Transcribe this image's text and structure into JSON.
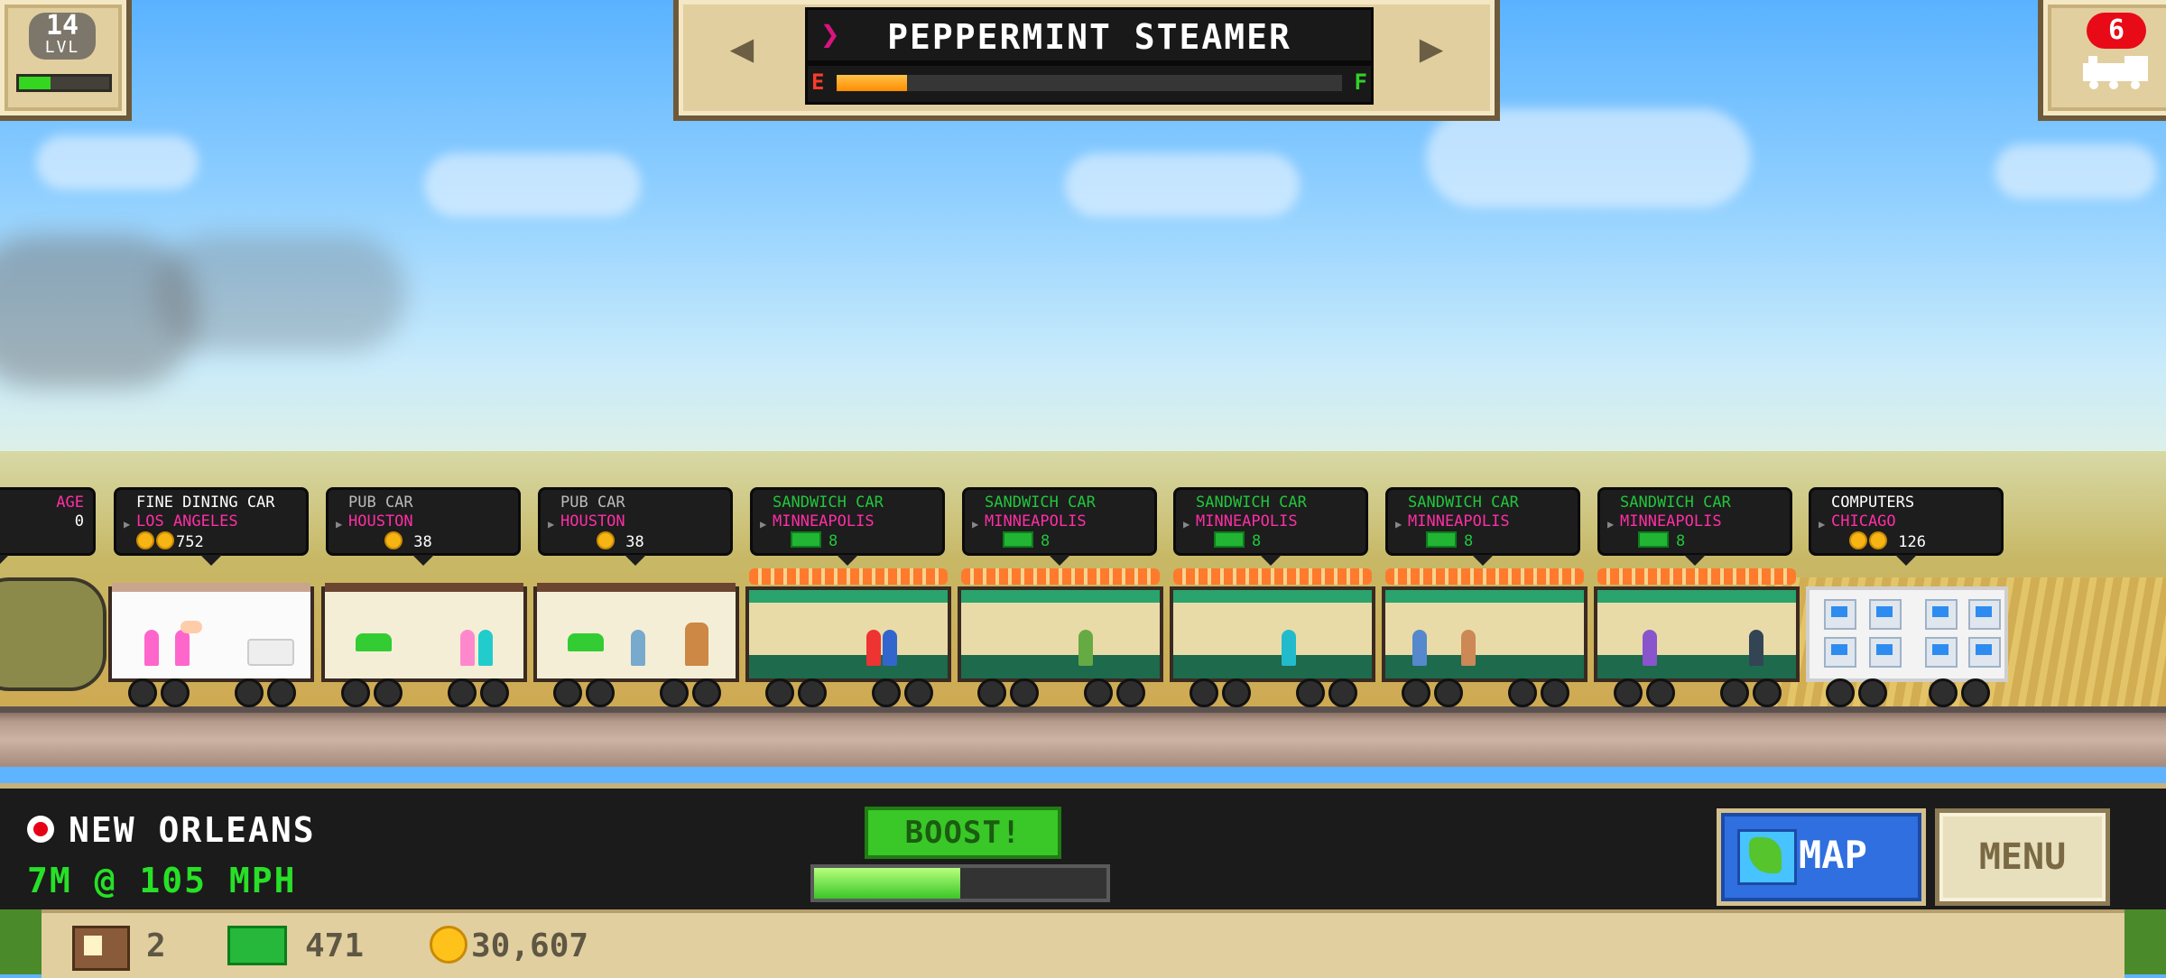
{
  "level": {
    "number": "14",
    "label": "LVL",
    "progress": 0.35
  },
  "train": {
    "name": "PEPPERMINT STEAMER",
    "fuel_empty_label": "E",
    "fuel_full_label": "F",
    "fuel_level": 0.14
  },
  "owned_trains": {
    "count": "6"
  },
  "cars": [
    {
      "title": "",
      "destination": "AGE",
      "amount": "0"
    },
    {
      "title": "FINE DINING CAR",
      "destination": "LOS ANGELES",
      "amount": "752"
    },
    {
      "title": "PUB CAR",
      "destination": "HOUSTON",
      "amount": "38"
    },
    {
      "title": "PUB CAR",
      "destination": "HOUSTON",
      "amount": "38"
    },
    {
      "title": "SANDWICH CAR",
      "destination": "MINNEAPOLIS",
      "amount": "8"
    },
    {
      "title": "SANDWICH CAR",
      "destination": "MINNEAPOLIS",
      "amount": "8"
    },
    {
      "title": "SANDWICH CAR",
      "destination": "MINNEAPOLIS",
      "amount": "8"
    },
    {
      "title": "SANDWICH CAR",
      "destination": "MINNEAPOLIS",
      "amount": "8"
    },
    {
      "title": "SANDWICH CAR",
      "destination": "MINNEAPOLIS",
      "amount": "8"
    },
    {
      "title": "COMPUTERS",
      "destination": "CHICAGO",
      "amount": "126"
    }
  ],
  "hud": {
    "station": "NEW ORLEANS",
    "status": "7M @ 105 MPH",
    "boost_label": "BOOST!",
    "boost_level": 0.5,
    "map_label": "MAP",
    "menu_label": "MENU"
  },
  "resources": {
    "cars": "2",
    "cash": "471",
    "coins": "30,607"
  },
  "icons": [
    "record-icon",
    "map-icon",
    "car-icon",
    "cash-icon",
    "coin-icon",
    "locomotive-icon",
    "chevron-left-icon",
    "chevron-right-icon"
  ]
}
